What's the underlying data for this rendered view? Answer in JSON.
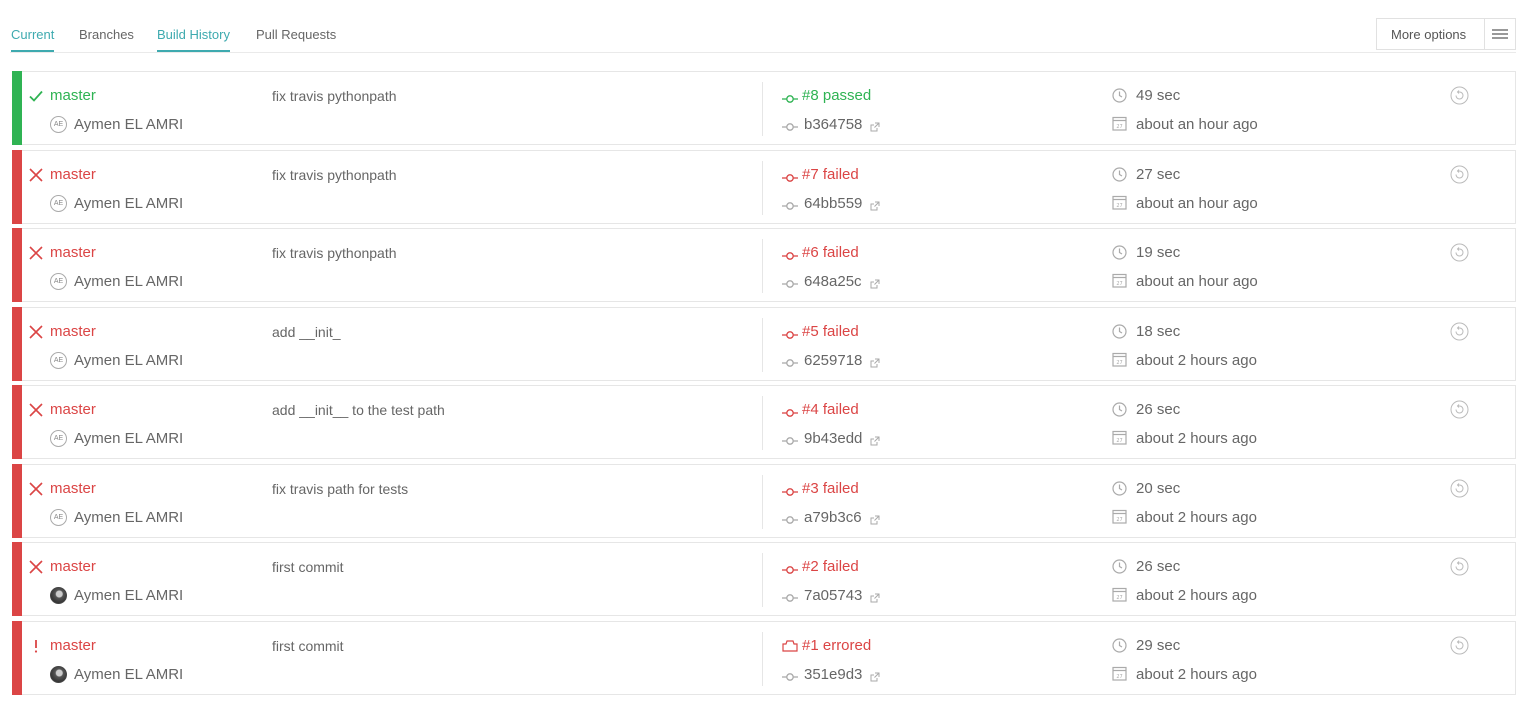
{
  "tabs": [
    {
      "label": "Current",
      "active": true
    },
    {
      "label": "Branches",
      "active": false
    },
    {
      "label": "Build History",
      "active": true
    },
    {
      "label": "Pull Requests",
      "active": false
    }
  ],
  "more_options_label": "More options",
  "colors": {
    "passed": "#2fb353",
    "failed": "#db4545",
    "accent": "#3eaaaf"
  },
  "builds": [
    {
      "state": "passed",
      "branch": "master",
      "author": "Aymen EL AMRI",
      "avatar": "AE",
      "message": "fix travis pythonpath",
      "number": "#8 passed",
      "sha": "b364758",
      "duration": "49 sec",
      "finished": "about an hour ago"
    },
    {
      "state": "failed",
      "branch": "master",
      "author": "Aymen EL AMRI",
      "avatar": "AE",
      "message": "fix travis pythonpath",
      "number": "#7 failed",
      "sha": "64bb559",
      "duration": "27 sec",
      "finished": "about an hour ago"
    },
    {
      "state": "failed",
      "branch": "master",
      "author": "Aymen EL AMRI",
      "avatar": "AE",
      "message": "fix travis pythonpath",
      "number": "#6 failed",
      "sha": "648a25c",
      "duration": "19 sec",
      "finished": "about an hour ago"
    },
    {
      "state": "failed",
      "branch": "master",
      "author": "Aymen EL AMRI",
      "avatar": "AE",
      "message": "add __init_",
      "number": "#5 failed",
      "sha": "6259718",
      "duration": "18 sec",
      "finished": "about 2 hours ago"
    },
    {
      "state": "failed",
      "branch": "master",
      "author": "Aymen EL AMRI",
      "avatar": "AE",
      "message": "add __init__ to the test path",
      "number": "#4 failed",
      "sha": "9b43edd",
      "duration": "26 sec",
      "finished": "about 2 hours ago"
    },
    {
      "state": "failed",
      "branch": "master",
      "author": "Aymen EL AMRI",
      "avatar": "AE",
      "message": "fix travis path for tests",
      "number": "#3 failed",
      "sha": "a79b3c6",
      "duration": "20 sec",
      "finished": "about 2 hours ago"
    },
    {
      "state": "failed",
      "branch": "master",
      "author": "Aymen EL AMRI",
      "avatar": "photo",
      "message": "first commit",
      "number": "#2 failed",
      "sha": "7a05743",
      "duration": "26 sec",
      "finished": "about 2 hours ago"
    },
    {
      "state": "errored",
      "branch": "master",
      "author": "Aymen EL AMRI",
      "avatar": "photo",
      "message": "first commit",
      "number": "#1 errored",
      "sha": "351e9d3",
      "duration": "29 sec",
      "finished": "about 2 hours ago"
    }
  ]
}
